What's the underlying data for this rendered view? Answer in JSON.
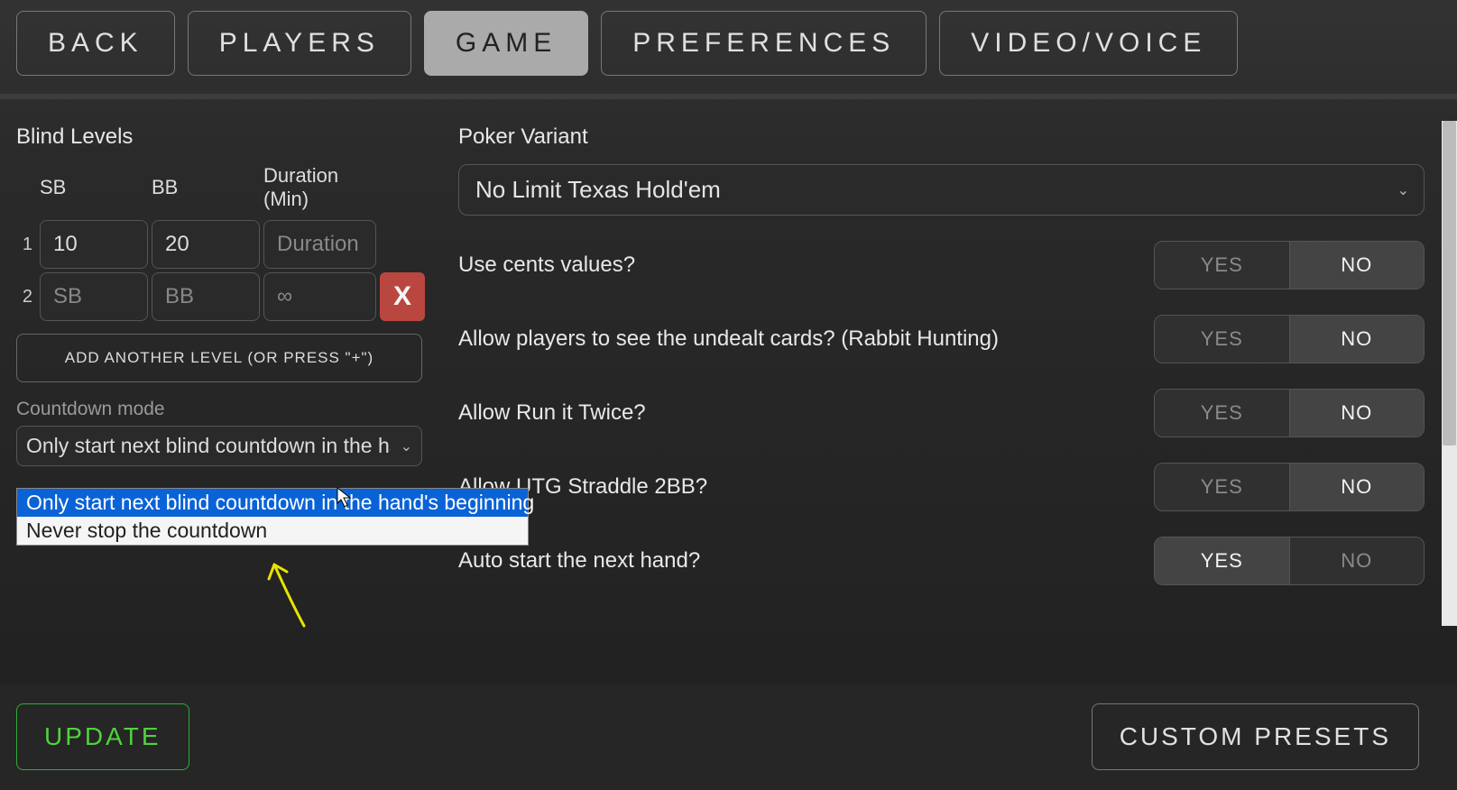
{
  "tabs": {
    "back": "BACK",
    "players": "PLAYERS",
    "game": "GAME",
    "preferences": "PREFERENCES",
    "video": "VIDEO/VOICE"
  },
  "left": {
    "title": "Blind Levels",
    "headers": {
      "sb": "SB",
      "bb": "BB",
      "dur": "Duration (Min)"
    },
    "rows": [
      {
        "num": "1",
        "sb": "10",
        "bb": "20",
        "dur": "",
        "dur_ph": "Duration"
      },
      {
        "num": "2",
        "sb": "",
        "bb": "",
        "sb_ph": "SB",
        "bb_ph": "BB",
        "dur": "",
        "dur_ph": "∞"
      }
    ],
    "delete_label": "X",
    "add_label": "ADD ANOTHER LEVEL (OR PRESS \"+\")",
    "countdown_label": "Countdown mode",
    "countdown_selected": "Only start next blind countdown in the han",
    "countdown_options": [
      "Only start next blind countdown in the hand's beginning",
      "Never stop the countdown"
    ]
  },
  "right": {
    "variant_label": "Poker Variant",
    "variant_value": "No Limit Texas Hold'em",
    "options": [
      {
        "label": "Use cents values?",
        "value": "NO"
      },
      {
        "label": "Allow players to see the undealt cards? (Rabbit Hunting)",
        "value": "NO"
      },
      {
        "label": "Allow Run it Twice?",
        "value": "NO"
      },
      {
        "label": "Allow UTG Straddle 2BB?",
        "value": "NO"
      },
      {
        "label": "Auto start the next hand?",
        "value": "YES"
      }
    ],
    "yes": "YES",
    "no": "NO"
  },
  "footer": {
    "update": "UPDATE",
    "presets": "CUSTOM PRESETS"
  }
}
